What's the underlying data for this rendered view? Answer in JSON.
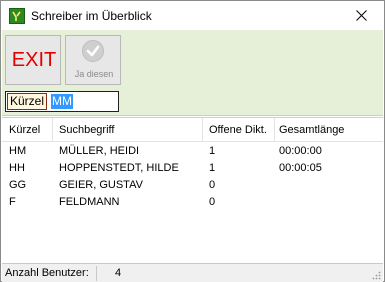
{
  "window": {
    "title": "Schreiber im Überblick",
    "icon": "app-logo-icon"
  },
  "toolbar": {
    "exit_label": "EXIT",
    "jadiesen_label": "Ja diesen",
    "jadiesen_icon": "check-icon",
    "search": {
      "label": "Kürzel",
      "value": "MM"
    }
  },
  "table": {
    "columns": [
      "Kürzel",
      "Suchbegriff",
      "Offene Dikt.",
      "Gesamtlänge"
    ],
    "rows": [
      {
        "kuerzel": "HM",
        "suchbegriff": "MÜLLER, HEIDI",
        "offene": "1",
        "laenge": "00:00:00"
      },
      {
        "kuerzel": "HH",
        "suchbegriff": "HOPPENSTEDT, HILDE",
        "offene": "1",
        "laenge": "00:00:05"
      },
      {
        "kuerzel": "GG",
        "suchbegriff": "GEIER, GUSTAV",
        "offene": "0",
        "laenge": ""
      },
      {
        "kuerzel": "F",
        "suchbegriff": "FELDMANN",
        "offene": "0",
        "laenge": ""
      }
    ]
  },
  "status": {
    "label": "Anzahl Benutzer:",
    "value": "4"
  },
  "colors": {
    "toolbar_bg": "#e6f0d8",
    "exit_red": "#e30000",
    "selection_blue": "#3399ff"
  }
}
